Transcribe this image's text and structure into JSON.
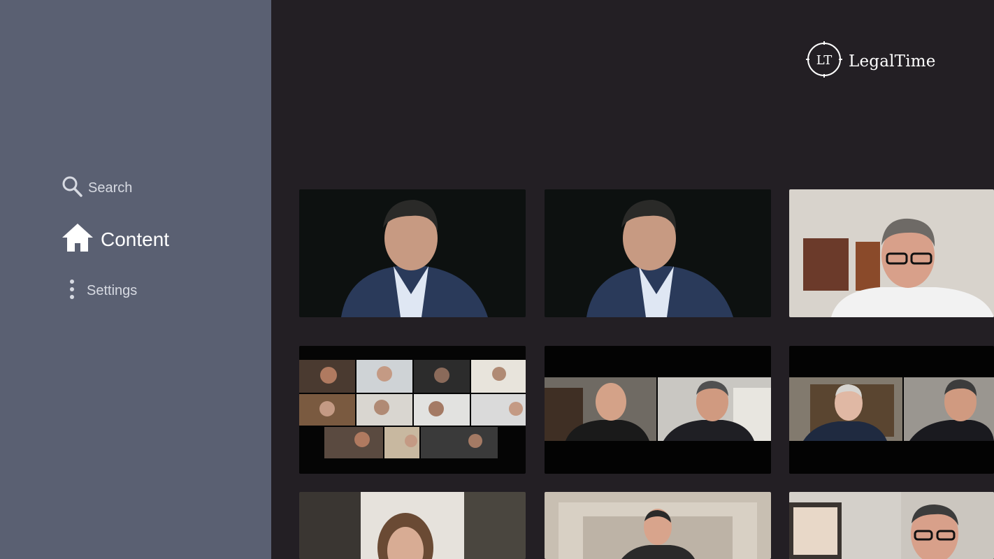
{
  "sidebar": {
    "items": [
      {
        "label": "Search",
        "icon": "search-icon"
      },
      {
        "label": "Content",
        "icon": "home-icon",
        "active": true
      },
      {
        "label": "Settings",
        "icon": "more-vertical-icon"
      }
    ]
  },
  "brand": {
    "logo_mark": "LT",
    "name": "LegalTime"
  },
  "colors": {
    "sidebar_bg": "#5a6072",
    "main_bg": "#231f24",
    "text_active": "#ffffff",
    "text_inactive": "#d7dae2"
  }
}
